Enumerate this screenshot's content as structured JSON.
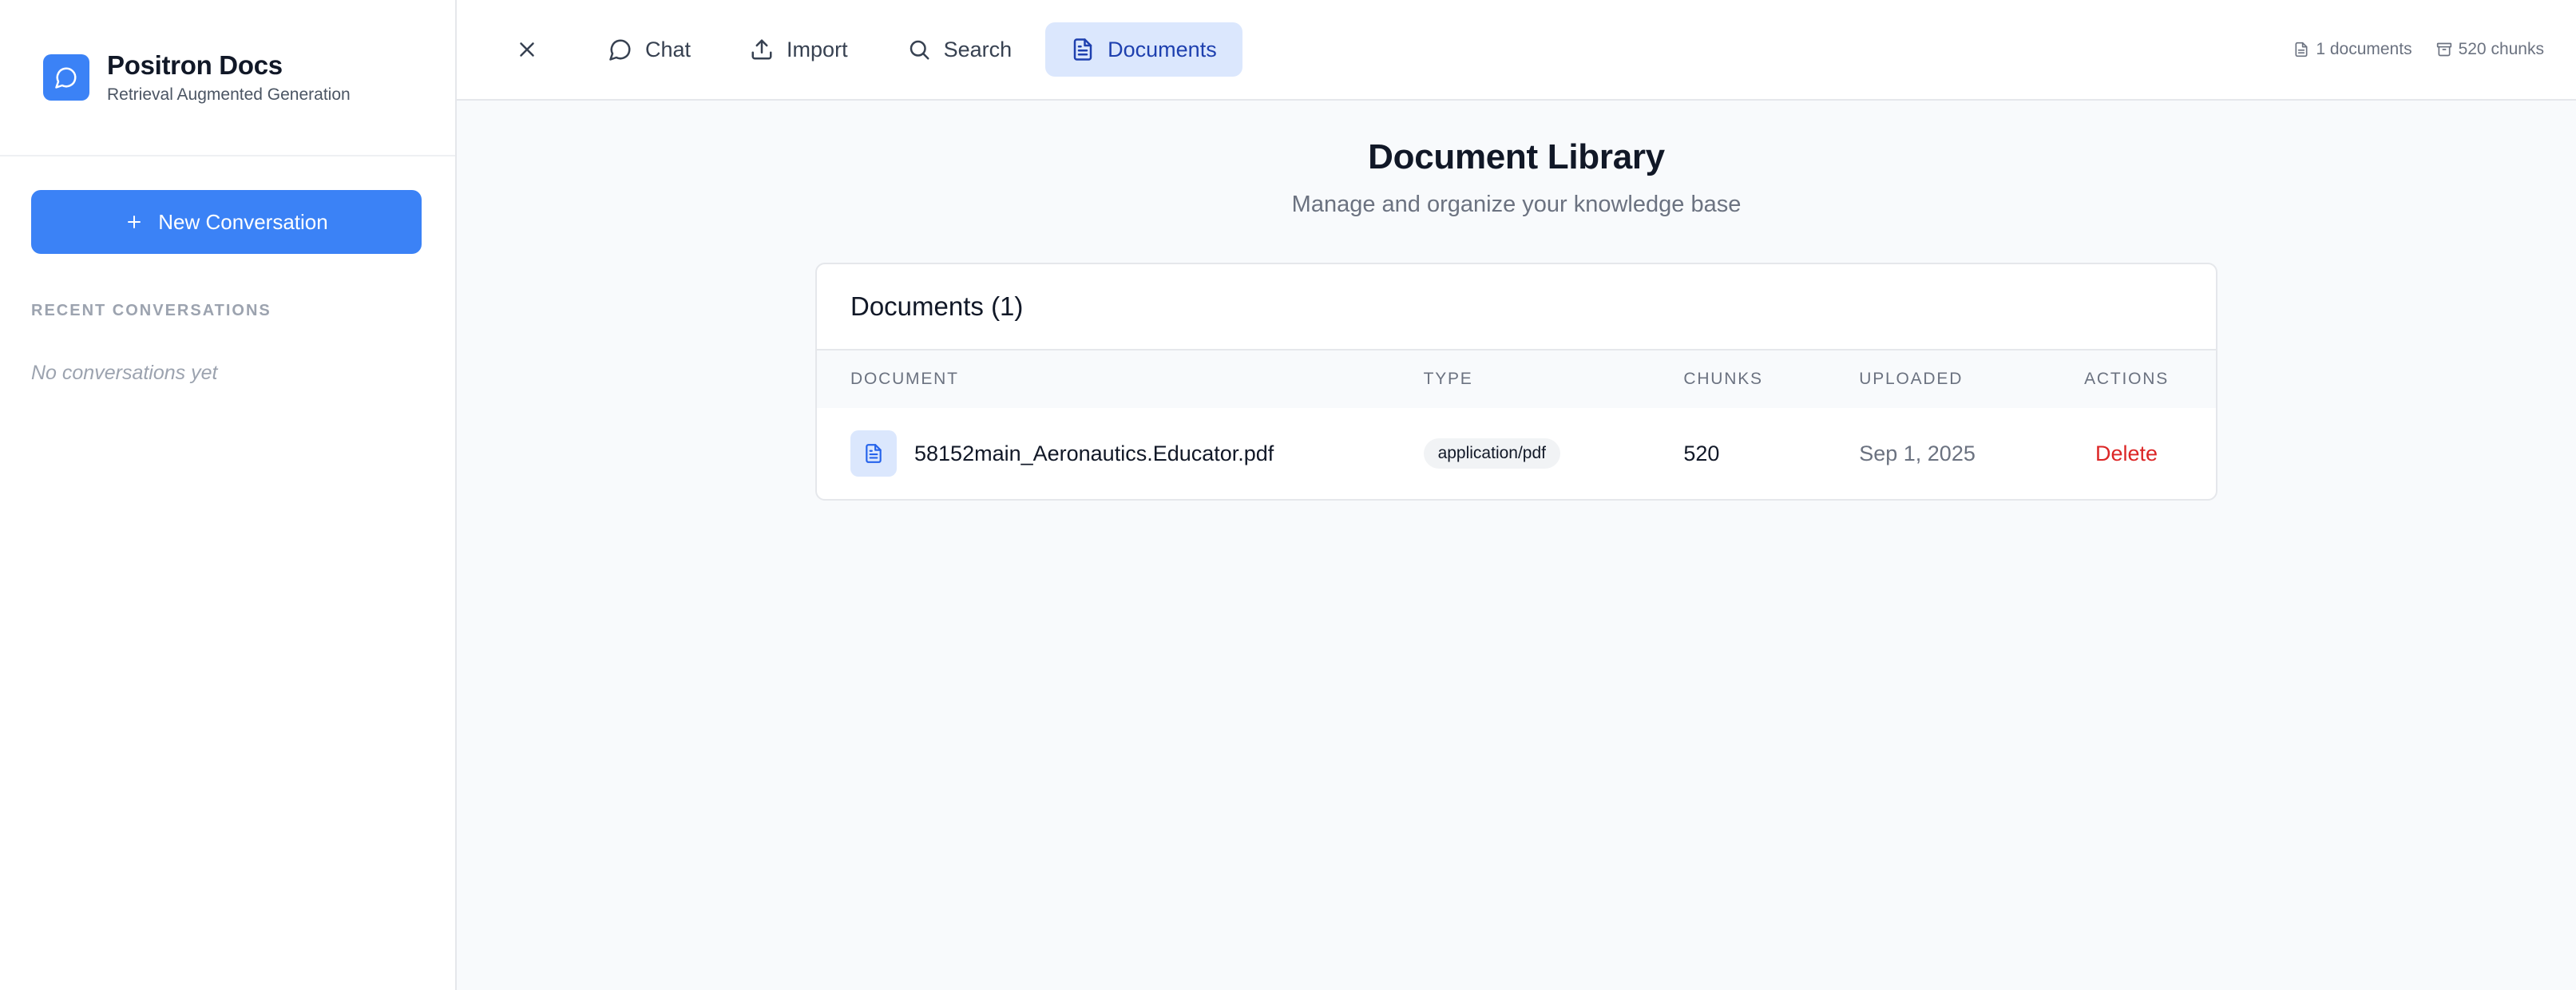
{
  "sidebar": {
    "brand_title": "Positron Docs",
    "brand_subtitle": "Retrieval Augmented Generation",
    "brand_icon": "chat-bubble-icon",
    "new_conversation_label": "New Conversation",
    "recent_label": "RECENT CONVERSATIONS",
    "empty_label": "No conversations yet"
  },
  "topbar": {
    "nav": [
      {
        "label": "Chat",
        "icon": "chat-bubble-icon",
        "active": false
      },
      {
        "label": "Import",
        "icon": "upload-icon",
        "active": false
      },
      {
        "label": "Search",
        "icon": "search-icon",
        "active": false
      },
      {
        "label": "Documents",
        "icon": "document-icon",
        "active": true
      }
    ],
    "stats": {
      "documents": "1 documents",
      "chunks": "520 chunks"
    }
  },
  "main": {
    "title": "Document Library",
    "subtitle": "Manage and organize your knowledge base",
    "card_title": "Documents (1)",
    "columns": [
      "DOCUMENT",
      "TYPE",
      "CHUNKS",
      "UPLOADED",
      "ACTIONS"
    ],
    "rows": [
      {
        "name": "58152main_Aeronautics.Educator.pdf",
        "type": "application/pdf",
        "chunks": "520",
        "uploaded": "Sep 1, 2025",
        "action": "Delete"
      }
    ]
  },
  "colors": {
    "accent": "#3b82f6",
    "active_nav_bg": "#dbe7fd",
    "active_nav_text": "#1e40af",
    "danger": "#dc2626"
  }
}
